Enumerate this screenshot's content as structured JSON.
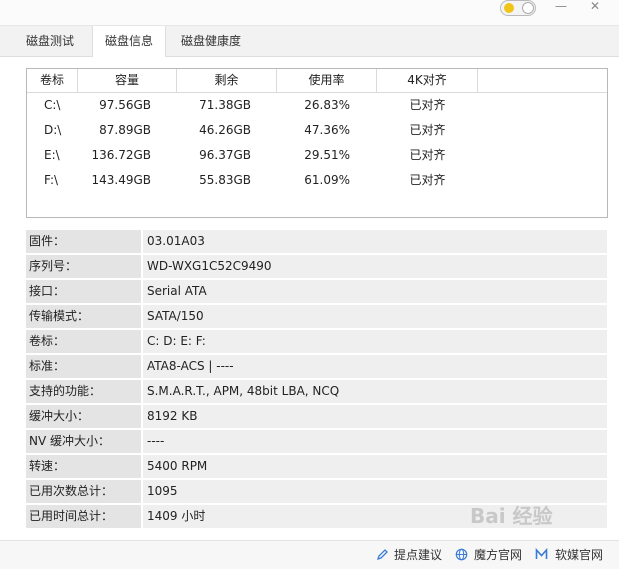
{
  "tabs": [
    {
      "label": "磁盘测试"
    },
    {
      "label": "磁盘信息"
    },
    {
      "label": "磁盘健康度"
    }
  ],
  "window_controls": {
    "minimize": "—",
    "close": "✕"
  },
  "volume_table": {
    "headers": [
      "卷标",
      "容量",
      "剩余",
      "使用率",
      "4K对齐"
    ],
    "rows": [
      {
        "volume": "C:\\",
        "capacity": "97.56GB",
        "free": "71.38GB",
        "usage": "26.83%",
        "align": "已对齐"
      },
      {
        "volume": "D:\\",
        "capacity": "87.89GB",
        "free": "46.26GB",
        "usage": "47.36%",
        "align": "已对齐"
      },
      {
        "volume": "E:\\",
        "capacity": "136.72GB",
        "free": "96.37GB",
        "usage": "29.51%",
        "align": "已对齐"
      },
      {
        "volume": "F:\\",
        "capacity": "143.49GB",
        "free": "55.83GB",
        "usage": "61.09%",
        "align": "已对齐"
      }
    ]
  },
  "info": [
    {
      "label": "固件：",
      "value": "03.01A03"
    },
    {
      "label": "序列号：",
      "value": "WD-WXG1C52C9490"
    },
    {
      "label": "接口：",
      "value": "Serial ATA"
    },
    {
      "label": "传输模式：",
      "value": "SATA/150"
    },
    {
      "label": "卷标：",
      "value": "C: D: E: F:"
    },
    {
      "label": "标准：",
      "value": "ATA8-ACS | ----"
    },
    {
      "label": "支持的功能：",
      "value": "S.M.A.R.T., APM, 48bit LBA, NCQ"
    },
    {
      "label": "缓冲大小：",
      "value": "8192 KB"
    },
    {
      "label": "NV 缓冲大小：",
      "value": "----"
    },
    {
      "label": "转速：",
      "value": "5400 RPM"
    },
    {
      "label": "已用次数总计：",
      "value": "1095"
    },
    {
      "label": "已用时间总计：",
      "value": "1409 小时"
    }
  ],
  "footer": {
    "feedback": "提点建议",
    "official_site": "魔方官网",
    "ruanmei_site": "软媒官网"
  },
  "watermark": "Bai 经验",
  "colors": {
    "toggle_sun": "#f0c419",
    "footer_icon": "#3a7bd5"
  }
}
